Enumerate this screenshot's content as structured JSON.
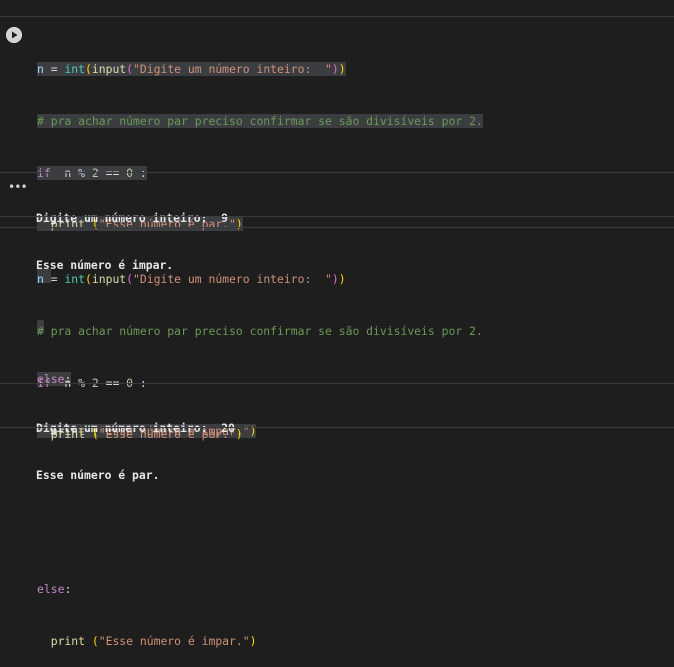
{
  "cell1": {
    "line1": {
      "a": "n",
      "b": " = ",
      "c": "int",
      "d": "(",
      "e": "input",
      "f": "(",
      "g": "\"Digite um número inteiro:  \"",
      "h": ")",
      "i": ")"
    },
    "line2": "# pra achar número par preciso confirmar se são divisíveis por 2.",
    "line3": {
      "kw": "if",
      "rest_a": "  n % ",
      "num1": "2",
      "rest_b": " == ",
      "num2": "0",
      "rest_c": " :"
    },
    "line4": {
      "indent": "  ",
      "fn": "print",
      "sp": " ",
      "p": "(",
      "str": "\"Esse número é par.\"",
      "pc": ")"
    },
    "line7": {
      "kw": "else",
      "colon": ":"
    },
    "line8": {
      "indent": "  ",
      "fn": "print",
      "sp": " ",
      "p": "(",
      "str": "\"Esse número é impar.\"",
      "pc": ")"
    },
    "output": [
      "Digite um número inteiro:  9",
      "Esse número é impar."
    ]
  },
  "cell2": {
    "line1": {
      "a": "n",
      "b": " = ",
      "c": "int",
      "d": "(",
      "e": "input",
      "f": "(",
      "g": "\"Digite um número inteiro:  \"",
      "h": ")",
      "i": ")"
    },
    "line2": "# pra achar número par preciso confirmar se são divisíveis por 2.",
    "line3": {
      "kw": "if",
      "rest_a": "  n % ",
      "num1": "2",
      "rest_b": " == ",
      "num2": "0",
      "rest_c": " :"
    },
    "line4": {
      "indent": "  ",
      "fn": "print",
      "sp": " ",
      "p": "(",
      "str": "\"Esse número é par.\"",
      "pc": ")"
    },
    "line7": {
      "kw": "else",
      "colon": ":"
    },
    "line8": {
      "indent": "  ",
      "fn": "print",
      "sp": " ",
      "p": "(",
      "str": "\"Esse número é impar.\"",
      "pc": ")"
    },
    "output": [
      "Digite um número inteiro:  20",
      "Esse número é par."
    ]
  },
  "icons": {
    "run": "play-circle-icon",
    "output_menu": "more-horizontal-icon"
  },
  "output_menu_glyph": "•••"
}
